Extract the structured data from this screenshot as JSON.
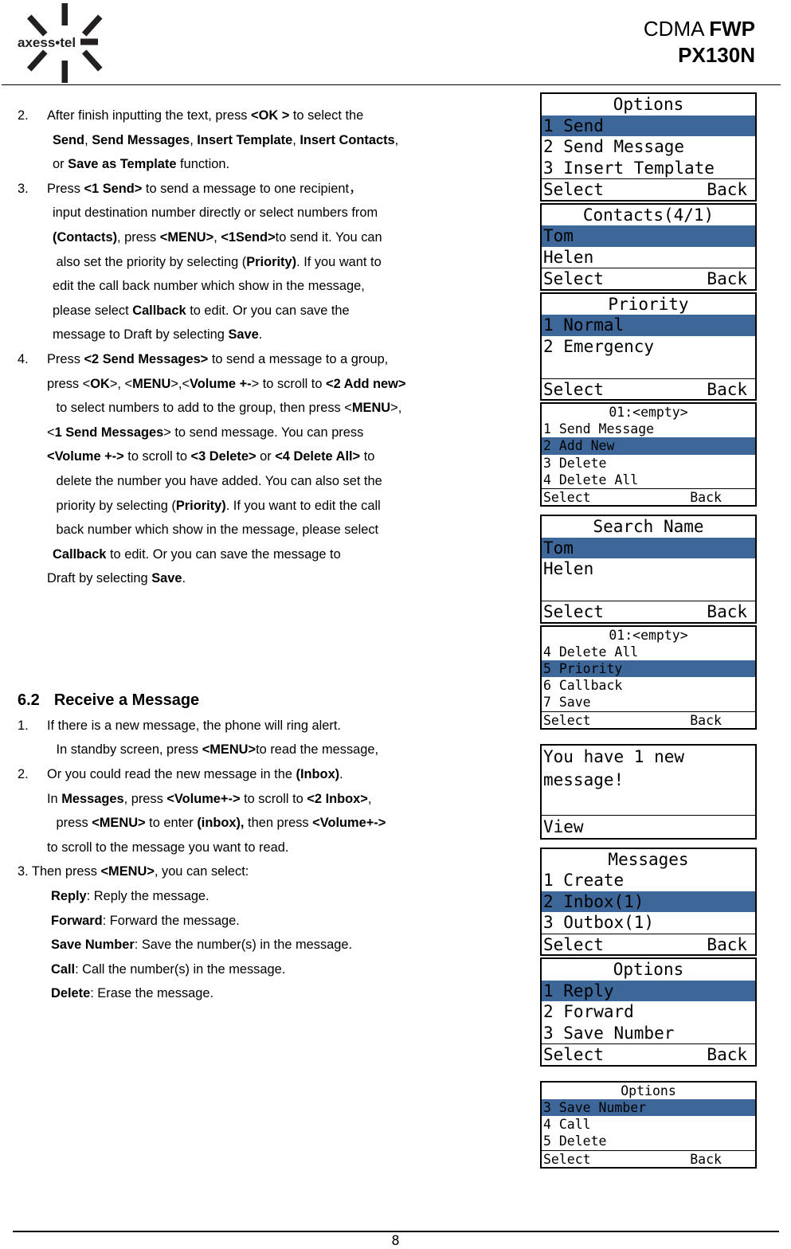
{
  "header": {
    "logo_name": "axess-tel-logo",
    "logo_text": "axess•tel",
    "title_line1_light": "CDMA ",
    "title_line1_bold": "FWP",
    "title_line2_bold": "PX130N"
  },
  "colors": {
    "highlight": "#3d6799",
    "text": "#000000",
    "background": "#ffffff"
  },
  "content": {
    "step2": {
      "number": "2.",
      "lines": [
        "After finish inputting the text, press <OK > to select the",
        "Send, Send Messages, Insert Template, Insert Contacts,",
        "or Save as Template function."
      ]
    },
    "step3": {
      "number": "3.",
      "lines": [
        "Press <1 Send> to send a message to one recipient，",
        "input destination number directly or select numbers from",
        "(Contacts), press <MENU>, <1Send>to send it. You can",
        "also set the priority by selecting (Priority). If you want to",
        "edit the call back number which show in the message,",
        "please select Callback to edit. Or you can save the",
        "message to Draft by selecting Save."
      ]
    },
    "step4": {
      "number": "4.",
      "lines": [
        "Press <2 Send Messages> to send a message to a group,",
        "press <OK>, <MENU>,<Volume +-> to scroll to <2 Add new>",
        "to select numbers to add to the group, then press <MENU>,",
        "<1 Send Messages> to send message. You can press",
        "<Volume +-> to scroll to <3 Delete> or <4 Delete All> to",
        "delete the number you have added. You can also set the",
        "priority by selecting (Priority). If you want to edit the call",
        "back number which show in the message, please select",
        "Callback to edit. Or you can save the message to",
        "Draft by selecting Save."
      ]
    },
    "section_heading": {
      "number": "6.2",
      "title": "Receive a Message"
    },
    "rstep1": {
      "number": "1.",
      "lines": [
        "If there is a new message, the phone will ring alert.",
        "In standby screen, press <MENU>to read the message,"
      ]
    },
    "rstep2": {
      "number": "2.",
      "lines": [
        "Or you could read the new message in the (Inbox).",
        "In Messages, press <Volume+-> to scroll to <2 Inbox>,",
        "press <MENU> to enter (inbox), then press <Volume+->",
        "to scroll to the message you want to read."
      ]
    },
    "rstep3": {
      "line": "3. Then press <MENU>, you can select:"
    },
    "definitions": [
      {
        "term": "Reply",
        "desc": ": Reply the message."
      },
      {
        "term": "Forward",
        "desc": ": Forward the message."
      },
      {
        "term": "Save Number",
        "desc": ": Save the number(s) in the message."
      },
      {
        "term": "Call",
        "desc": ": Call the number(s) in the message."
      },
      {
        "term": "Delete",
        "desc": ": Erase the message."
      }
    ]
  },
  "screens": [
    {
      "id": "options-send",
      "size": "big",
      "title": "Options",
      "rows": [
        {
          "text": "1 Send",
          "selected": true
        },
        {
          "text": "2 Send Message",
          "selected": false
        },
        {
          "text": "3 Insert Template",
          "selected": false
        }
      ],
      "left_softkey": "Select",
      "right_softkey": "Back"
    },
    {
      "id": "contacts",
      "size": "big",
      "title": "Contacts(4/1)",
      "rows": [
        {
          "text": "Tom",
          "selected": true
        },
        {
          "text": "Helen",
          "selected": false
        }
      ],
      "left_softkey": "Select",
      "right_softkey": "Back"
    },
    {
      "id": "priority",
      "size": "big",
      "title": "Priority",
      "rows": [
        {
          "text": "1 Normal",
          "selected": true
        },
        {
          "text": "2 Emergency",
          "selected": false
        }
      ],
      "left_softkey": "Select",
      "right_softkey": "Back"
    },
    {
      "id": "group-01-empty-a",
      "size": "small",
      "title": "01:<empty>",
      "rows": [
        {
          "text": "1 Send Message",
          "selected": false
        },
        {
          "text": "2 Add New",
          "selected": true
        },
        {
          "text": "3 Delete",
          "selected": false
        },
        {
          "text": "4 Delete All",
          "selected": false
        }
      ],
      "left_softkey": "Select",
      "right_softkey": "Back"
    },
    {
      "id": "search-name",
      "size": "big",
      "title": "Search Name",
      "rows": [
        {
          "text": "Tom",
          "selected": true
        },
        {
          "text": "Helen",
          "selected": false
        }
      ],
      "left_softkey": "Select",
      "right_softkey": "Back"
    },
    {
      "id": "group-01-empty-b",
      "size": "small",
      "title": "01:<empty>",
      "rows": [
        {
          "text": "4 Delete All",
          "selected": false
        },
        {
          "text": "5 Priority",
          "selected": true
        },
        {
          "text": "6 Callback",
          "selected": false
        },
        {
          "text": "7 Save",
          "selected": false
        }
      ],
      "left_softkey": "Select",
      "right_softkey": "Back"
    },
    {
      "id": "new-message-alert",
      "size": "alert",
      "alert_lines": [
        "You have 1 new",
        "message!"
      ],
      "left_softkey": "View",
      "right_softkey": ""
    },
    {
      "id": "messages-menu",
      "size": "big",
      "title": "Messages",
      "rows": [
        {
          "text": "1 Create",
          "selected": false
        },
        {
          "text": "2 Inbox(1)",
          "selected": true
        },
        {
          "text": "3 Outbox(1)",
          "selected": false
        }
      ],
      "left_softkey": "Select",
      "right_softkey": "Back"
    },
    {
      "id": "options-reply",
      "size": "big",
      "title": "Options",
      "rows": [
        {
          "text": "1 Reply",
          "selected": true
        },
        {
          "text": "2 Forward",
          "selected": false
        },
        {
          "text": "3 Save Number",
          "selected": false
        }
      ],
      "left_softkey": "Select",
      "right_softkey": "Back"
    },
    {
      "id": "options-save-number",
      "size": "small",
      "title": "Options",
      "rows": [
        {
          "text": "3 Save Number",
          "selected": true
        },
        {
          "text": "4 Call",
          "selected": false
        },
        {
          "text": "5 Delete",
          "selected": false
        }
      ],
      "left_softkey": "Select",
      "right_softkey": "Back"
    }
  ],
  "footer": {
    "page_number": "8"
  }
}
